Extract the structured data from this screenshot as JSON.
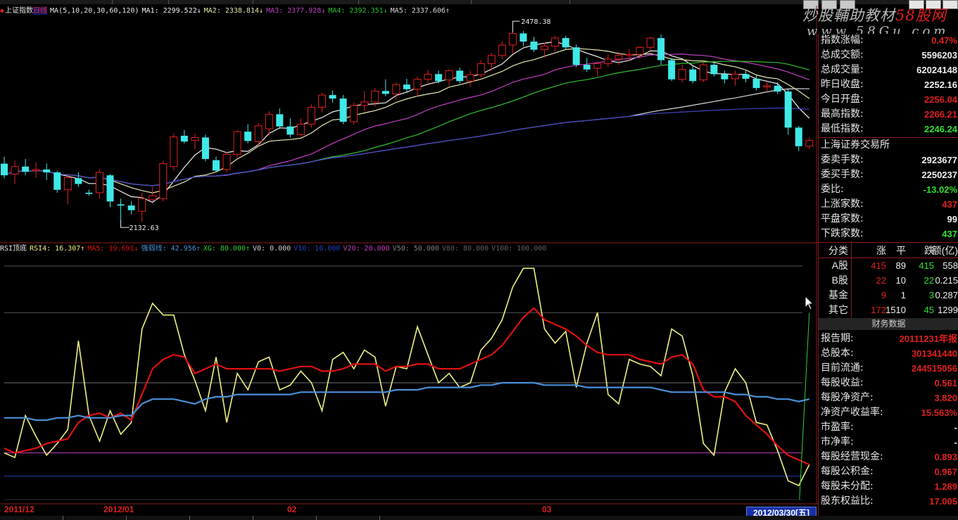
{
  "main_header": {
    "index_name": "上证指数",
    "period": "日线",
    "ma_params": "MA(5,10,20,30,60,120)",
    "ma1": "MA1: 2299.522↓",
    "ma2": "MA2: 2338.814↓",
    "ma3": "MA3: 2377.928↓",
    "ma4": "MA4: 2392.351↓",
    "ma5": "MA5: 2337.606↑"
  },
  "price_annotations": {
    "high_label": "2478.38",
    "low_label": "2132.63"
  },
  "rsi_header": {
    "name": "RSI顶底",
    "rsi4": "RSI4: 16.307↑",
    "ma5": "MA5: 19.691↓",
    "strength": "强弱线: 42.956↑",
    "xg": "XG: 80.000↑",
    "v0": "V0: 0.000",
    "v10": "V10: 10.000",
    "v20": "V20: 20.000",
    "v50": "V50: 50.000",
    "v80": "V80: 80.000",
    "v100": "V100: 100.000"
  },
  "logo": {
    "line1_prefix": "炒股輔助教材",
    "line1_brand": "58股网",
    "line2": "www.58Gu.com"
  },
  "right_panel": {
    "top_rows": [
      {
        "label": "指数涨幅:",
        "value": "0.47%",
        "color": "#e02020"
      },
      {
        "label": "总成交额:",
        "value": "5596203",
        "color": "#f0f0f0"
      },
      {
        "label": "总成交量:",
        "value": "62024148",
        "color": "#f0f0f0"
      },
      {
        "label": "昨日收盘:",
        "value": "2252.16",
        "color": "#f0f0f0"
      },
      {
        "label": "今日开盘:",
        "value": "2256.04",
        "color": "#e02020"
      },
      {
        "label": "最高指数:",
        "value": "2266.21",
        "color": "#e02020"
      },
      {
        "label": "最低指数:",
        "value": "2246.24",
        "color": "#30e030"
      }
    ],
    "exchange": "上海证券交易所",
    "exchange_rows": [
      {
        "label": "委卖手数:",
        "value": "2923677",
        "color": "#f0f0f0"
      },
      {
        "label": "委买手数:",
        "value": "2250237",
        "color": "#f0f0f0"
      },
      {
        "label": "委比:",
        "value": "-13.02%",
        "color": "#30e030"
      },
      {
        "label": "上涨家数:",
        "value": "437",
        "color": "#e02020"
      },
      {
        "label": "平盘家数:",
        "value": "99",
        "color": "#f0f0f0"
      },
      {
        "label": "下跌家数:",
        "value": "437",
        "color": "#30e030"
      }
    ],
    "table_headers": [
      "分类",
      "涨",
      "平",
      "跌",
      "额(亿)"
    ],
    "table_rows": [
      {
        "name": "A股",
        "up": "415",
        "flat": "89",
        "down": "415",
        "amount": "558"
      },
      {
        "name": "B股",
        "up": "22",
        "flat": "10",
        "down": "22",
        "amount": "0.215"
      },
      {
        "name": "基金",
        "up": "9",
        "flat": "1",
        "down": "3",
        "amount": "0.287"
      },
      {
        "name": "其它",
        "up": "172",
        "flat": "1510",
        "down": "45",
        "amount": "1299"
      }
    ],
    "finance_title": "财务数据",
    "finance_rows": [
      {
        "label": "报告期:",
        "value": "20111231年报",
        "color": "#e02020"
      },
      {
        "label": "总股本:",
        "value": "301341440",
        "color": "#e02020"
      },
      {
        "label": "目前流通:",
        "value": "244515056",
        "color": "#e02020"
      },
      {
        "label": "每股收益:",
        "value": "0.561",
        "color": "#e02020"
      },
      {
        "label": "每股净资产:",
        "value": "3.820",
        "color": "#e02020"
      },
      {
        "label": "净资产收益率:",
        "value": "15.563%",
        "color": "#e02020"
      },
      {
        "label": "市盈率:",
        "value": "-",
        "color": "#f0f0f0"
      },
      {
        "label": "市净率:",
        "value": "-",
        "color": "#f0f0f0"
      },
      {
        "label": "每股经营现金:",
        "value": "0.893",
        "color": "#e02020"
      },
      {
        "label": "每股公积金:",
        "value": "0.967",
        "color": "#e02020"
      },
      {
        "label": "每股未分配:",
        "value": "1.289",
        "color": "#e02020"
      },
      {
        "label": "股东权益比:",
        "value": "17.005",
        "color": "#e02020"
      }
    ]
  },
  "date_axis": {
    "labels": [
      "2011/12",
      "2012/01",
      "02",
      "03"
    ],
    "cursor_date": "2012/03/30[五]"
  },
  "colors": {
    "up_candle": "#e02020",
    "down_candle": "#40e8e8",
    "rsi_line": "#f0f080",
    "rsi_ma": "#e01010",
    "strength_line": "#4a90d8",
    "xg_line": "#30d030"
  },
  "chart_data": [
    {
      "type": "candlestick",
      "title": "上证指数 日线",
      "ohlc": [
        [
          2250,
          2262,
          2225,
          2230
        ],
        [
          2232,
          2255,
          2215,
          2245
        ],
        [
          2245,
          2258,
          2230,
          2236
        ],
        [
          2238,
          2252,
          2226,
          2240
        ],
        [
          2240,
          2250,
          2222,
          2235
        ],
        [
          2235,
          2238,
          2200,
          2205
        ],
        [
          2205,
          2230,
          2180,
          2226
        ],
        [
          2225,
          2235,
          2210,
          2215
        ],
        [
          2200,
          2205,
          2195,
          2198
        ],
        [
          2200,
          2240,
          2190,
          2235
        ],
        [
          2230,
          2232,
          2175,
          2185
        ],
        [
          2180,
          2190,
          2150,
          2178
        ],
        [
          2178,
          2185,
          2163,
          2170
        ],
        [
          2168,
          2200,
          2150,
          2190
        ],
        [
          2188,
          2210,
          2185,
          2195
        ],
        [
          2190,
          2255,
          2185,
          2250
        ],
        [
          2245,
          2302,
          2238,
          2296
        ],
        [
          2298,
          2308,
          2285,
          2288
        ],
        [
          2290,
          2302,
          2275,
          2295
        ],
        [
          2295,
          2300,
          2254,
          2258
        ],
        [
          2256,
          2262,
          2236,
          2238
        ],
        [
          2240,
          2270,
          2235,
          2266
        ],
        [
          2266,
          2308,
          2260,
          2305
        ],
        [
          2305,
          2318,
          2285,
          2289
        ],
        [
          2288,
          2320,
          2280,
          2315
        ],
        [
          2310,
          2340,
          2298,
          2335
        ],
        [
          2335,
          2345,
          2310,
          2314
        ],
        [
          2314,
          2328,
          2295,
          2300
        ],
        [
          2300,
          2328,
          2296,
          2318
        ],
        [
          2318,
          2352,
          2312,
          2347
        ],
        [
          2347,
          2372,
          2338,
          2368
        ],
        [
          2368,
          2376,
          2355,
          2362
        ],
        [
          2362,
          2368,
          2318,
          2322
        ],
        [
          2322,
          2355,
          2317,
          2350
        ],
        [
          2350,
          2375,
          2340,
          2356
        ],
        [
          2356,
          2380,
          2348,
          2375
        ],
        [
          2375,
          2395,
          2366,
          2370
        ],
        [
          2370,
          2390,
          2360,
          2386
        ],
        [
          2386,
          2396,
          2372,
          2378
        ],
        [
          2378,
          2400,
          2365,
          2395
        ],
        [
          2395,
          2412,
          2388,
          2404
        ],
        [
          2404,
          2410,
          2388,
          2392
        ],
        [
          2394,
          2412,
          2384,
          2410
        ],
        [
          2410,
          2415,
          2388,
          2392
        ],
        [
          2392,
          2410,
          2382,
          2403
        ],
        [
          2403,
          2428,
          2398,
          2422
        ],
        [
          2422,
          2440,
          2410,
          2436
        ],
        [
          2436,
          2460,
          2430,
          2454
        ],
        [
          2454,
          2478,
          2440,
          2474
        ],
        [
          2474,
          2478,
          2452,
          2460
        ],
        [
          2460,
          2468,
          2442,
          2446
        ],
        [
          2446,
          2458,
          2432,
          2452
        ],
        [
          2452,
          2470,
          2444,
          2466
        ],
        [
          2466,
          2470,
          2446,
          2450
        ],
        [
          2450,
          2455,
          2416,
          2420
        ],
        [
          2420,
          2432,
          2408,
          2412
        ],
        [
          2414,
          2426,
          2400,
          2422
        ],
        [
          2422,
          2438,
          2416,
          2430
        ],
        [
          2430,
          2442,
          2420,
          2436
        ],
        [
          2436,
          2447,
          2426,
          2438
        ],
        [
          2438,
          2452,
          2432,
          2450
        ],
        [
          2450,
          2468,
          2444,
          2466
        ],
        [
          2466,
          2472,
          2420,
          2428
        ],
        [
          2428,
          2432,
          2392,
          2395
        ],
        [
          2395,
          2420,
          2390,
          2412
        ],
        [
          2412,
          2418,
          2388,
          2392
        ],
        [
          2394,
          2425,
          2390,
          2420
        ],
        [
          2420,
          2426,
          2400,
          2404
        ],
        [
          2404,
          2410,
          2388,
          2395
        ],
        [
          2396,
          2410,
          2384,
          2404
        ],
        [
          2404,
          2410,
          2390,
          2396
        ],
        [
          2396,
          2402,
          2376,
          2380
        ],
        [
          2382,
          2390,
          2375,
          2384
        ],
        [
          2384,
          2390,
          2370,
          2374
        ],
        [
          2374,
          2378,
          2300,
          2312
        ],
        [
          2312,
          2315,
          2272,
          2280
        ],
        [
          2280,
          2295,
          2275,
          2290
        ]
      ],
      "ma_lines": [
        {
          "name": "MA1",
          "color": "#f0f0f0"
        },
        {
          "name": "MA2",
          "color": "#e8e8b0"
        },
        {
          "name": "MA3",
          "color": "#c040c0"
        },
        {
          "name": "MA4",
          "color": "#30c030"
        },
        {
          "name": "MA5",
          "color": "#d8d8d8"
        },
        {
          "name": "MA6",
          "color": "#4040c0"
        }
      ],
      "ylim": [
        2120,
        2500
      ]
    },
    {
      "type": "line",
      "title": "RSI顶底",
      "ylim": [
        0,
        100
      ],
      "reference_lines": [
        0,
        10,
        20,
        50,
        80,
        100
      ],
      "series": [
        {
          "name": "RSI4",
          "values": [
            20,
            18,
            36,
            27,
            19,
            24,
            30,
            68,
            36,
            25,
            38,
            28,
            33,
            73,
            84,
            79,
            79,
            62,
            51,
            38,
            61,
            33,
            54,
            47,
            59,
            61,
            47,
            49,
            55,
            50,
            38,
            60,
            63,
            56,
            64,
            61,
            40,
            57,
            56,
            74,
            62,
            50,
            54,
            48,
            50,
            64,
            69,
            77,
            91,
            99,
            99,
            73,
            67,
            72,
            48,
            67,
            80,
            45,
            41,
            60,
            58,
            57,
            53,
            73,
            70,
            53,
            24,
            19,
            46,
            56,
            50,
            33,
            32,
            21,
            8,
            6,
            15
          ]
        },
        {
          "name": "MA5",
          "values": [
            22,
            20,
            21,
            22,
            24,
            25,
            26,
            33,
            36,
            37,
            35,
            37,
            34,
            45,
            56,
            60,
            62,
            61,
            54,
            56,
            58,
            56,
            56,
            56,
            56,
            56,
            55,
            56,
            57,
            57,
            55,
            55,
            56,
            58,
            58,
            58,
            55,
            57,
            57,
            58,
            58,
            56,
            56,
            56,
            58,
            60,
            62,
            66,
            72,
            78,
            82,
            77,
            75,
            73,
            70,
            66,
            63,
            62,
            62,
            62,
            60,
            59,
            58,
            61,
            62,
            58,
            47,
            44,
            44,
            42,
            36,
            32,
            28,
            23,
            19,
            17,
            15
          ]
        },
        {
          "name": "强弱线",
          "values": [
            35,
            35,
            35,
            34,
            34,
            35,
            35,
            36,
            35,
            35,
            35,
            36,
            36,
            41,
            43,
            43,
            43,
            42,
            41,
            43,
            44,
            44,
            45,
            45,
            45,
            45,
            45,
            45,
            46,
            46,
            46,
            46,
            46,
            46,
            46,
            46,
            46,
            47,
            47,
            47,
            48,
            48,
            48,
            48,
            48,
            49,
            49,
            50,
            50,
            50,
            50,
            49,
            49,
            49,
            49,
            48,
            48,
            48,
            48,
            48,
            48,
            48,
            47,
            46,
            46,
            46,
            46,
            46,
            46,
            45,
            45,
            44,
            44,
            43,
            43,
            42,
            43
          ]
        },
        {
          "name": "XG",
          "values": [
            80,
            80,
            80,
            80,
            80,
            80,
            80,
            80,
            80,
            80,
            80,
            80,
            80,
            80,
            80,
            80,
            80,
            80,
            80,
            80,
            80,
            80,
            80,
            80,
            80,
            80,
            80,
            80,
            80,
            80,
            80,
            80,
            80,
            80,
            80,
            80,
            80,
            80,
            80,
            80,
            80,
            80,
            80,
            80,
            80,
            80,
            80,
            80,
            80,
            80,
            80,
            80,
            80,
            80,
            80,
            80,
            80,
            80,
            80,
            80,
            80,
            80,
            80,
            80,
            80,
            80,
            80,
            80,
            80,
            80,
            80,
            80,
            80,
            80,
            80,
            80,
            80
          ]
        }
      ]
    }
  ]
}
